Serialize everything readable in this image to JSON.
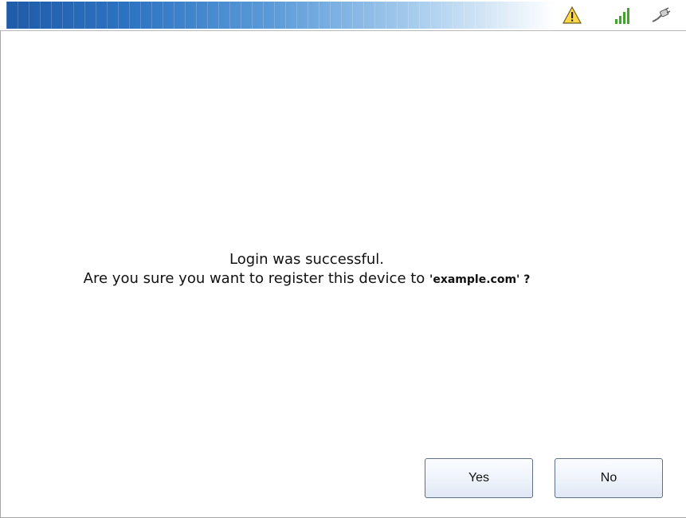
{
  "status_bar": {
    "icons": [
      "warning-icon",
      "signal-strength-icon",
      "power-plug-icon"
    ],
    "accent_color": "#2c73c2"
  },
  "dialog": {
    "line1": "Login was successful.",
    "line2_prefix": "Are you sure you want to register this device to ",
    "domain": "'example.com'",
    "line2_suffix": " ?"
  },
  "buttons": {
    "yes_label": "Yes",
    "no_label": "No"
  }
}
